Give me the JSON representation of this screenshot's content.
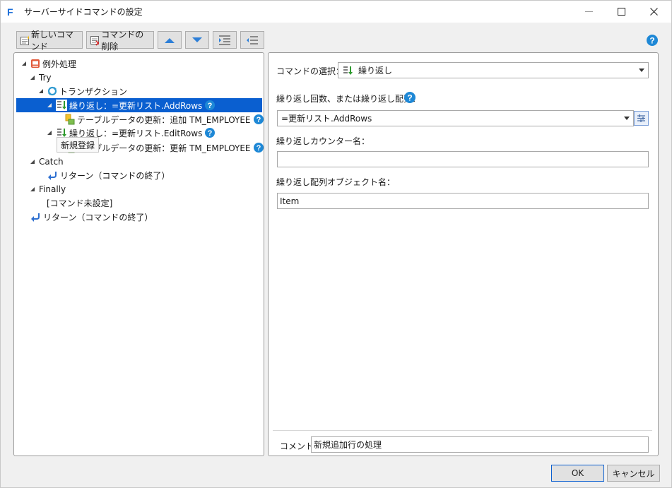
{
  "window": {
    "title": "サーバーサイドコマンドの設定",
    "app_icon_letter": "F"
  },
  "toolbar": {
    "new_command_label": "新しいコマンド",
    "delete_command_label": "コマンドの削除"
  },
  "tree": {
    "items": [
      {
        "label": "例外処理"
      },
      {
        "label": "Try"
      },
      {
        "label": "トランザクション"
      },
      {
        "label": "繰り返し：=更新リスト.AddRows"
      },
      {
        "label": "テーブルデータの更新：追加 TM_EMPLOYEE"
      },
      {
        "label": "繰り返し：=更新リスト.EditRows"
      },
      {
        "label": "テーブルデータの更新：更新 TM_EMPLOYEE"
      },
      {
        "label": "Catch"
      },
      {
        "label": "リターン（コマンドの終了）"
      },
      {
        "label": "Finally"
      },
      {
        "label": "[コマンド未設定]"
      },
      {
        "label": "リターン（コマンドの終了）"
      }
    ],
    "tooltip": "新規登録"
  },
  "detail": {
    "command_select_label": "コマンドの選択：",
    "command_select_value": "繰り返し",
    "repeat_count_label": "繰り返し回数、または繰り返し配列：",
    "repeat_count_value": "=更新リスト.AddRows",
    "counter_name_label": "繰り返しカウンター名：",
    "counter_name_value": "",
    "array_object_label": "繰り返し配列オブジェクト名：",
    "array_object_value": "Item",
    "comment_label": "コメント",
    "comment_value": "新規追加行の処理"
  },
  "buttons": {
    "ok": "OK",
    "cancel": "キャンセル"
  },
  "colors": {
    "selection": "#0a5fd0",
    "help_icon": "#1e88d6",
    "repeat_icon_green": "#2e9a2e"
  }
}
